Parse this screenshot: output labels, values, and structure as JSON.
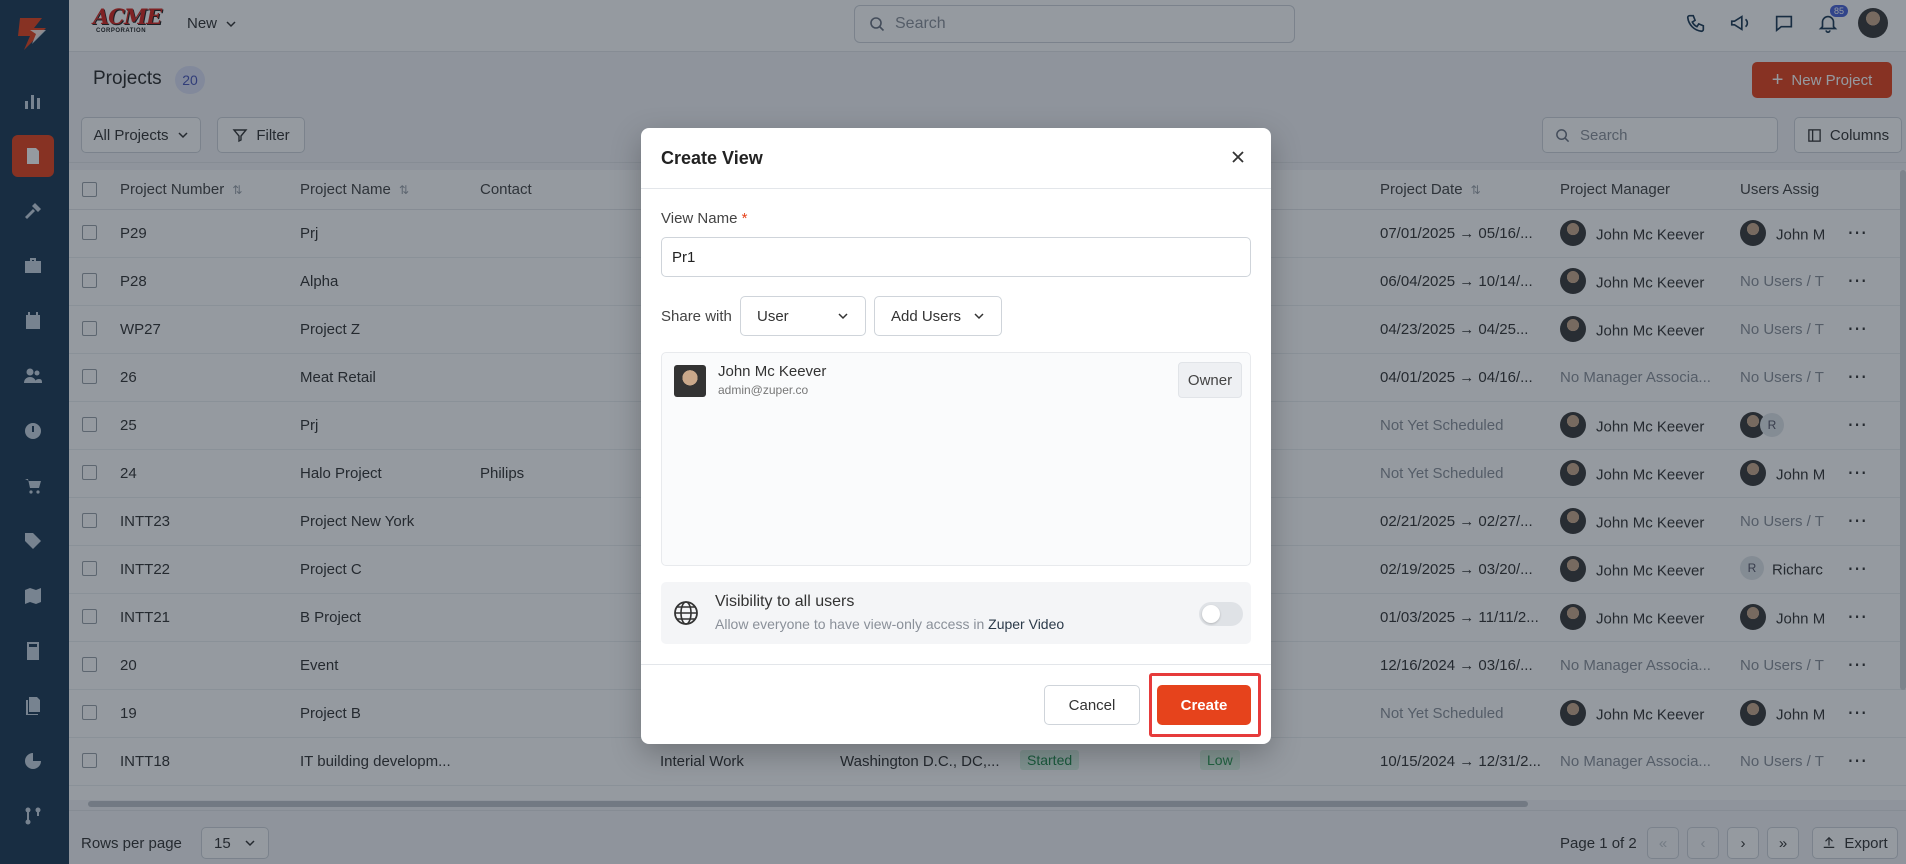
{
  "header": {
    "brand_top": "ACME",
    "brand_bottom": "CORPORATION",
    "new_label": "New",
    "search_placeholder": "Search",
    "notification_count": "85"
  },
  "page": {
    "title": "Projects",
    "count": "20",
    "new_project_label": "New Project"
  },
  "toolbar": {
    "view_select": "All Projects",
    "filter_label": "Filter",
    "search_placeholder": "Search",
    "columns_label": "Columns"
  },
  "table": {
    "columns": [
      "Project Number",
      "Project Name",
      "Contact",
      "Project Date",
      "Project Manager",
      "Users Assig"
    ],
    "rows": [
      {
        "number": "P29",
        "name": "Prj",
        "contact": "",
        "date": "07/01/2025 → 05/16/...",
        "manager": "John Mc Keever",
        "users": "John M"
      },
      {
        "number": "P28",
        "name": "Alpha",
        "contact": "",
        "date": "06/04/2025 → 10/14/...",
        "manager": "John Mc Keever",
        "users": "No Users / T"
      },
      {
        "number": "WP27",
        "name": "Project Z",
        "contact": "",
        "date": "04/23/2025 → 04/25...",
        "manager": "John Mc Keever",
        "users": "No Users / T"
      },
      {
        "number": "26",
        "name": "Meat Retail",
        "contact": "",
        "date": "04/01/2025 → 04/16/...",
        "manager": "No Manager Associa...",
        "users": "No Users / T"
      },
      {
        "number": "25",
        "name": "Prj",
        "contact": "",
        "date": "Not Yet Scheduled",
        "manager": "John Mc Keever",
        "users": "R"
      },
      {
        "number": "24",
        "name": "Halo Project",
        "contact": "Philips",
        "date": "Not Yet Scheduled",
        "manager": "John Mc Keever",
        "users": "John M"
      },
      {
        "number": "INTT23",
        "name": "Project New York",
        "contact": "",
        "date": "02/21/2025 → 02/27/...",
        "manager": "John Mc Keever",
        "users": "No Users / T"
      },
      {
        "number": "INTT22",
        "name": "Project C",
        "contact": "",
        "date": "02/19/2025 → 03/20/...",
        "manager": "John Mc Keever",
        "users": "Richarc"
      },
      {
        "number": "INTT21",
        "name": "B Project",
        "contact": "",
        "date": "01/03/2025 → 11/11/2...",
        "manager": "John Mc Keever",
        "users": "John M"
      },
      {
        "number": "20",
        "name": "Event",
        "contact": "",
        "date": "12/16/2024 → 03/16/...",
        "manager": "No Manager Associa...",
        "users": "No Users / T"
      },
      {
        "number": "19",
        "name": "Project B",
        "contact": "",
        "date": "Not Yet Scheduled",
        "manager": "John Mc Keever",
        "users": "John M"
      },
      {
        "number": "INTT18",
        "name": "IT building developm...",
        "contact": "",
        "category": "Interial Work",
        "location": "Washington D.C., DC,...",
        "status": "Started",
        "priority": "Low",
        "date": "10/15/2024 → 12/31/2...",
        "manager": "No Manager Associa...",
        "users": "No Users / T"
      }
    ]
  },
  "footer": {
    "rows_per_page_label": "Rows per page",
    "rows_per_page_value": "15",
    "page_info": "Page 1 of 2",
    "export_label": "Export"
  },
  "modal": {
    "title": "Create View",
    "view_name_label": "View Name",
    "required_mark": "*",
    "view_name_value": "Pr1",
    "share_with_label": "Share with",
    "share_type": "User",
    "add_users_label": "Add Users",
    "shared_user": {
      "name": "John Mc Keever",
      "email": "admin@zuper.co",
      "role": "Owner"
    },
    "visibility_title": "Visibility to all users",
    "visibility_sub_prefix": "Allow everyone to have view-only access in",
    "visibility_sub_app": "Zuper Video",
    "visibility_on": false,
    "cancel_label": "Cancel",
    "create_label": "Create"
  }
}
